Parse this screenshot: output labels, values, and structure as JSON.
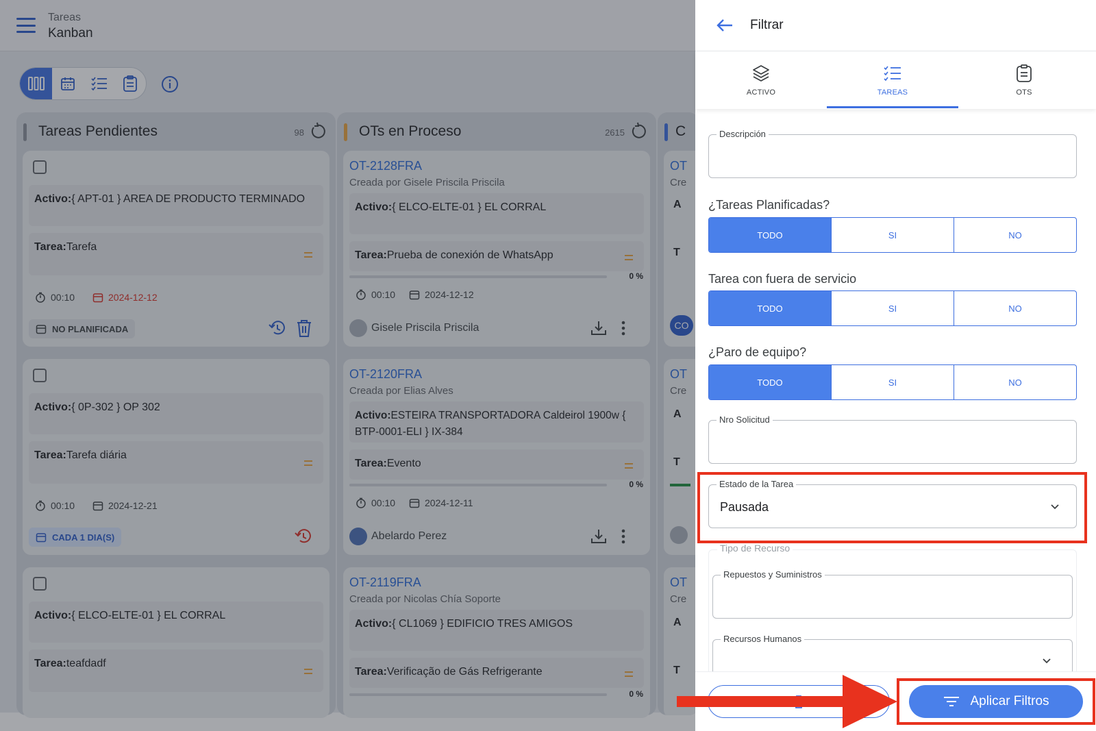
{
  "appbar": {
    "title": "Tareas",
    "subtitle": "Kanban"
  },
  "columns": [
    {
      "title": "Tareas Pendientes",
      "count": "98",
      "color": "#8a8f99"
    },
    {
      "title": "OTs en Proceso",
      "count": "2615",
      "color": "#e8a33d"
    },
    {
      "title": "C",
      "count": "",
      "color": "#3d6fe0"
    }
  ],
  "pending_cards": [
    {
      "activo_label": "Activo:",
      "activo": "{ APT-01 } AREA DE PRODUCTO TERMINADO",
      "tarea_label": "Tarea:",
      "tarea": "Tarefa",
      "time": "00:10",
      "date": "2024-12-12",
      "chip": "NO PLANIFICADA"
    },
    {
      "activo_label": "Activo:",
      "activo": "{ 0P-302 } OP 302",
      "tarea_label": "Tarea:",
      "tarea": "Tarefa diária",
      "time": "00:10",
      "date": "2024-12-21",
      "chip": "CADA 1 DIA(S)"
    },
    {
      "activo_label": "Activo:",
      "activo": "{ ELCO-ELTE-01 } EL CORRAL",
      "tarea_label": "Tarea:",
      "tarea": "teafdadf"
    }
  ],
  "ot_cards": [
    {
      "id": "OT-2128FRA",
      "by": "Creada por Gisele Priscila Priscila",
      "activo_label": "Activo:",
      "activo": "{ ELCO-ELTE-01 } EL CORRAL",
      "tarea_label": "Tarea:",
      "tarea": "Prueba de conexión de WhatsApp",
      "pct": "0 %",
      "time": "00:10",
      "date": "2024-12-12",
      "user": "Gisele Priscila Priscila"
    },
    {
      "id": "OT-2120FRA",
      "by": "Creada por Elias Alves",
      "activo_label": "Activo:",
      "activo": "ESTEIRA TRANSPORTADORA Caldeirol  1900w { BTP-0001-ELI } IX-384",
      "tarea_label": "Tarea:",
      "tarea": "Evento",
      "pct": "0 %",
      "time": "00:10",
      "date": "2024-12-11",
      "user": "Abelardo Perez"
    },
    {
      "id": "OT-2119FRA",
      "by": "Creada por Nicolas Chía Soporte",
      "activo_label": "Activo:",
      "activo": "{ CL1069 } EDIFICIO TRES AMIGOS",
      "tarea_label": "Tarea:",
      "tarea": "Verificação de Gás Refrigerante",
      "pct": "0 %"
    }
  ],
  "third_col_fragments": [
    "OT",
    "Cre",
    "A",
    "T",
    "CO"
  ],
  "panel": {
    "title": "Filtrar",
    "tabs": [
      {
        "label": "ACTIVO",
        "icon": "layers-icon"
      },
      {
        "label": "TAREAS",
        "icon": "checklist-icon"
      },
      {
        "label": "OTS",
        "icon": "clipboard-icon"
      }
    ],
    "descripcion_label": "Descripción",
    "q_planificadas": "¿Tareas Planificadas?",
    "q_fuera_servicio": "Tarea con fuera de servicio",
    "q_paro": "¿Paro de equipo?",
    "seg_options": [
      "TODO",
      "SI",
      "NO"
    ],
    "selected_option": "TODO",
    "nro_solicitud_label": "Nro Solicitud",
    "estado_label": "Estado de la Tarea",
    "estado_value": "Pausada",
    "tipo_recurso_label": "Tipo de Recurso",
    "repuestos_label": "Repuestos y Suministros",
    "recursos_humanos_label": "Recursos Humanos",
    "apply_label": "Aplicar Filtros"
  },
  "colors": {
    "accent": "#4a80ea",
    "highlight": "#e8321e",
    "date_red": "#d93025"
  }
}
